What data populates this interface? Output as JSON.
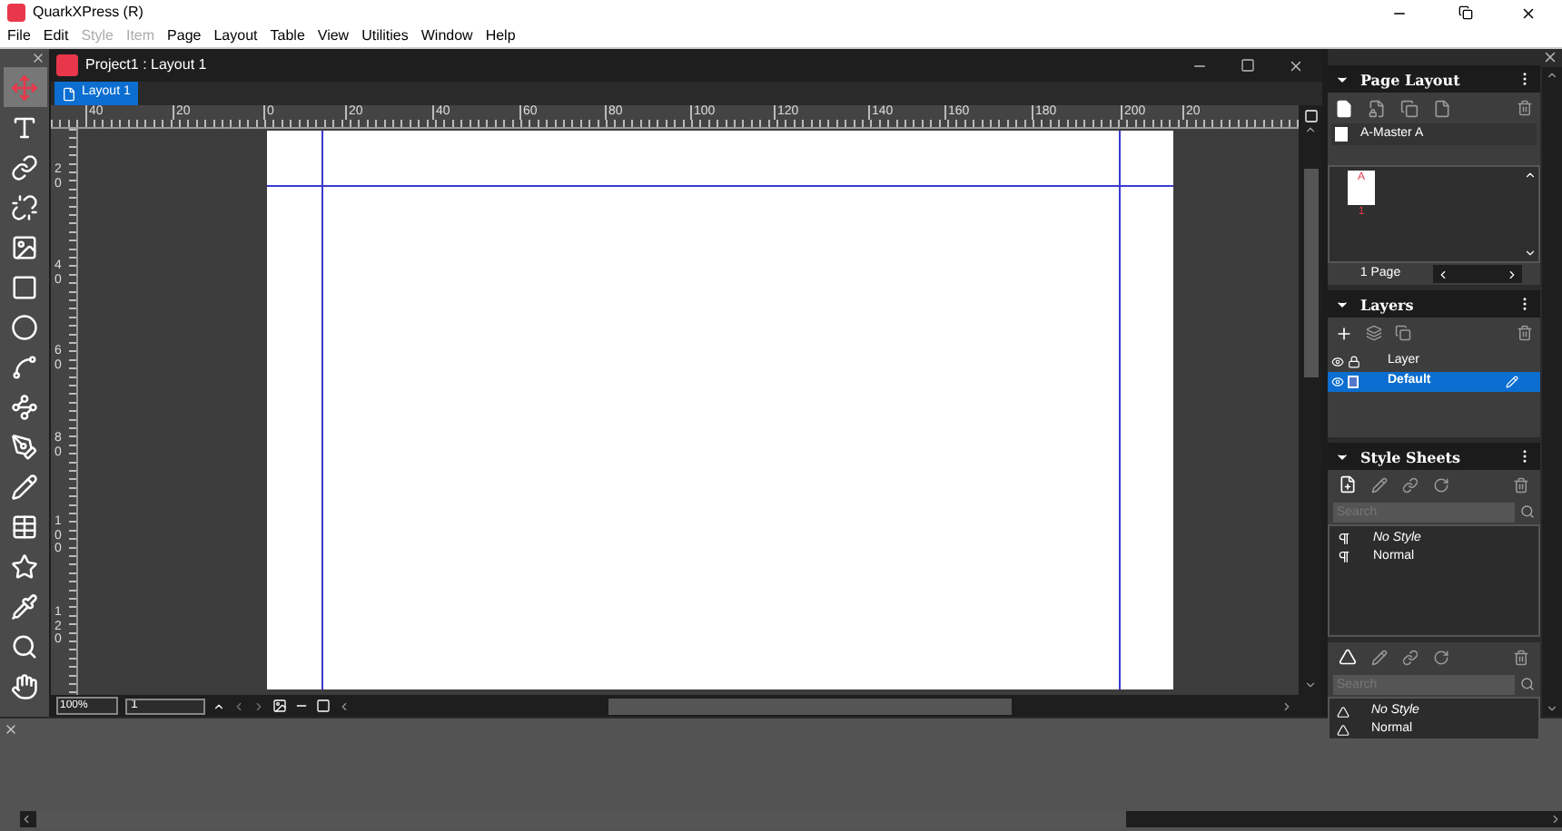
{
  "app": {
    "title": "QuarkXPress (R)"
  },
  "menu": [
    {
      "label": "File",
      "disabled": false
    },
    {
      "label": "Edit",
      "disabled": false
    },
    {
      "label": "Style",
      "disabled": true
    },
    {
      "label": "Item",
      "disabled": true
    },
    {
      "label": "Page",
      "disabled": false
    },
    {
      "label": "Layout",
      "disabled": false
    },
    {
      "label": "Table",
      "disabled": false
    },
    {
      "label": "View",
      "disabled": false
    },
    {
      "label": "Utilities",
      "disabled": false
    },
    {
      "label": "Window",
      "disabled": false
    },
    {
      "label": "Help",
      "disabled": false
    }
  ],
  "tools": [
    {
      "kind": "move",
      "selected": true
    },
    {
      "kind": "text",
      "selected": false
    },
    {
      "kind": "link",
      "selected": false
    },
    {
      "kind": "unlink",
      "selected": false
    },
    {
      "kind": "picture",
      "selected": false
    },
    {
      "kind": "rectangle",
      "selected": false
    },
    {
      "kind": "oval",
      "selected": false
    },
    {
      "kind": "line",
      "selected": false
    },
    {
      "kind": "point",
      "selected": false
    },
    {
      "kind": "pen",
      "selected": false
    },
    {
      "kind": "pencil",
      "selected": false
    },
    {
      "kind": "table",
      "selected": false
    },
    {
      "kind": "star",
      "selected": false
    },
    {
      "kind": "eyedropper",
      "selected": false
    },
    {
      "kind": "zoom",
      "selected": false
    },
    {
      "kind": "pan",
      "selected": false
    }
  ],
  "document": {
    "title": "Project1 : Layout 1",
    "tabs": [
      {
        "label": "Layout 1",
        "selected": true
      }
    ],
    "ruler_h": [
      "40",
      "20",
      "0",
      "20",
      "40",
      "60",
      "80",
      "100",
      "120",
      "140",
      "160",
      "180",
      "200",
      "20"
    ],
    "ruler_v": [
      "20",
      "40",
      "60",
      "80",
      "100",
      "120"
    ],
    "zoom": "100%",
    "page_number": "1"
  },
  "page_layout": {
    "title": "Page Layout",
    "master": "A-Master A",
    "thumb_letter": "A",
    "thumb_number": "1",
    "page_count": "1 Page"
  },
  "layers": {
    "title": "Layers",
    "items": [
      {
        "name": "Layer",
        "selected": false,
        "locked": true
      },
      {
        "name": "Default",
        "selected": true,
        "locked": false
      }
    ]
  },
  "style_sheets": {
    "title": "Style Sheets",
    "paragraph": {
      "placeholder": "Search",
      "items": [
        {
          "name": "No Style",
          "italic": true
        },
        {
          "name": "Normal",
          "italic": false
        }
      ]
    },
    "character": {
      "placeholder": "Search",
      "items": [
        {
          "name": "No Style",
          "italic": true
        },
        {
          "name": "Normal",
          "italic": false
        }
      ]
    }
  }
}
